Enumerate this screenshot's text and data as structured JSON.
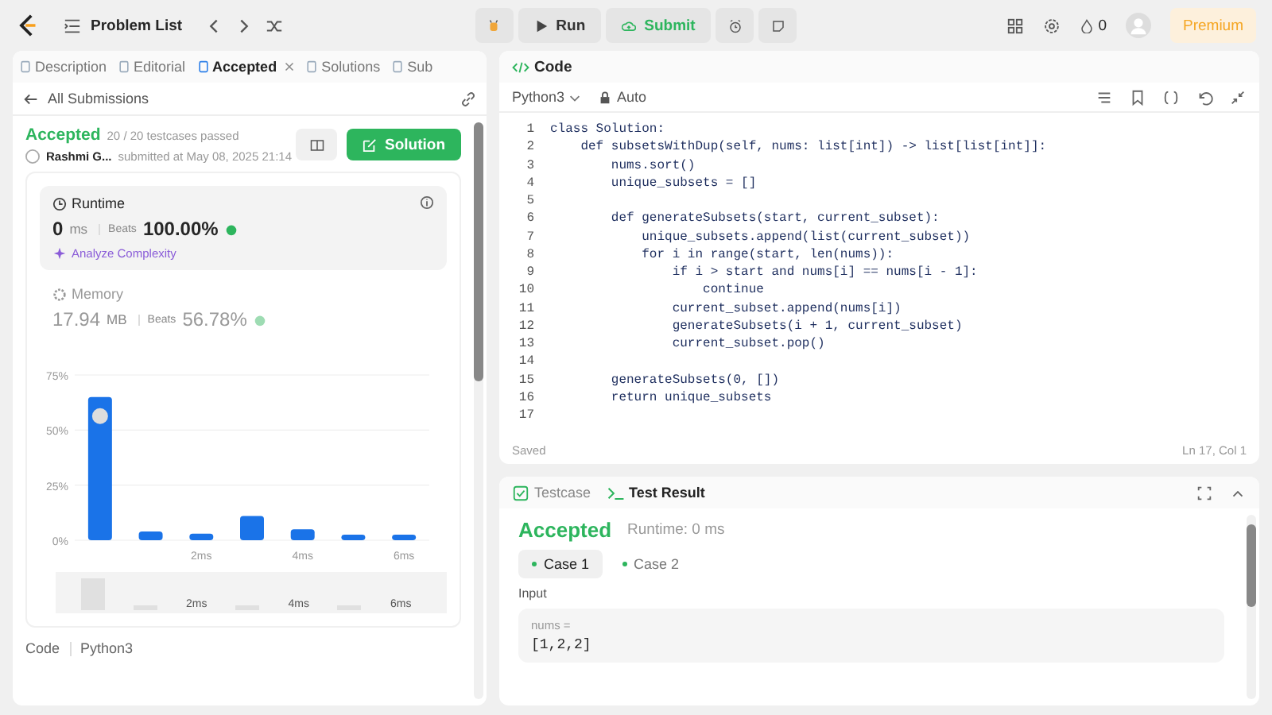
{
  "topbar": {
    "problem_list": "Problem List",
    "run": "Run",
    "submit": "Submit",
    "streak": "0",
    "premium": "Premium"
  },
  "left_tabs": [
    {
      "label": "Description",
      "selected": false,
      "closable": false
    },
    {
      "label": "Editorial",
      "selected": false,
      "closable": false
    },
    {
      "label": "Accepted",
      "selected": true,
      "closable": true
    },
    {
      "label": "Solutions",
      "selected": false,
      "closable": false
    },
    {
      "label": "Sub",
      "selected": false,
      "closable": false
    }
  ],
  "submission": {
    "back": "All Submissions",
    "status": "Accepted",
    "passed": "20 / 20 testcases passed",
    "user": "Rashmi G...",
    "submitted": "submitted at May 08, 2025 21:14",
    "solution_button": "Solution",
    "runtime": {
      "title": "Runtime",
      "value": "0",
      "unit": "ms",
      "beats_label": "Beats",
      "beats": "100.00%",
      "analyze": "Analyze Complexity",
      "selected": true
    },
    "memory": {
      "title": "Memory",
      "value": "17.94",
      "unit": "MB",
      "beats_label": "Beats",
      "beats": "56.78%",
      "selected": false
    },
    "chart_data": {
      "type": "bar",
      "x": [
        0,
        1,
        2,
        3,
        4,
        5,
        6
      ],
      "values": [
        65,
        4,
        3,
        11,
        5,
        2.5,
        2.5
      ],
      "xlim": [
        -0.5,
        6.5
      ],
      "ylim": [
        0,
        75
      ],
      "yticks": [
        {
          "value": 0,
          "label": "0%"
        },
        {
          "value": 25,
          "label": "25%"
        },
        {
          "value": 50,
          "label": "50%"
        },
        {
          "value": 75,
          "label": "75%"
        }
      ],
      "xticks": [
        {
          "value": 2,
          "label": "2ms"
        },
        {
          "value": 4,
          "label": "4ms"
        },
        {
          "value": 6,
          "label": "6ms"
        }
      ]
    },
    "overview_labels": [
      "2ms",
      "4ms",
      "6ms"
    ],
    "footer": {
      "code_label": "Code",
      "language": "Python3"
    }
  },
  "code": {
    "title": "Code",
    "language": "Python3",
    "mode": "Auto",
    "status": "Saved",
    "cursor": "Ln 17, Col 1",
    "lines": [
      {
        "number": "1",
        "text": "class Solution:"
      },
      {
        "number": "2",
        "text": "    def subsetsWithDup(self, nums: list[int]) -> list[list[int]]:"
      },
      {
        "number": "3",
        "text": "        nums.sort()"
      },
      {
        "number": "4",
        "text": "        unique_subsets = []"
      },
      {
        "number": "5"
      },
      {
        "number": "6",
        "text": "        def generateSubsets(start, current_subset):"
      },
      {
        "number": "7",
        "text": "            unique_subsets.append(list(current_subset))"
      },
      {
        "number": "8",
        "text": "            for i in range(start, len(nums)):"
      },
      {
        "number": "9",
        "text": "                if i > start and nums[i] == nums[i - 1]:"
      },
      {
        "number": "10",
        "text": "                    continue"
      },
      {
        "number": "11",
        "text": "                current_subset.append(nums[i])"
      },
      {
        "number": "12",
        "text": "                generateSubsets(i + 1, current_subset)"
      },
      {
        "number": "13",
        "text": "                current_subset.pop()"
      },
      {
        "number": "14"
      },
      {
        "number": "15",
        "text": "        generateSubsets(0, [])"
      },
      {
        "number": "16",
        "text": "        return unique_subsets"
      },
      {
        "number": "17"
      }
    ]
  },
  "bottom_tabs": [
    {
      "label": "Testcase",
      "selected": false,
      "kind": "check"
    },
    {
      "label": "Test Result",
      "selected": true,
      "kind": "terminal"
    }
  ],
  "result": {
    "status": "Accepted",
    "runtime": "Runtime: 0 ms",
    "cases": [
      {
        "label": "Case 1",
        "selected": true
      },
      {
        "label": "Case 2",
        "selected": false
      }
    ],
    "input_label": "Input",
    "var": "nums =",
    "value": "[1,2,2]"
  }
}
